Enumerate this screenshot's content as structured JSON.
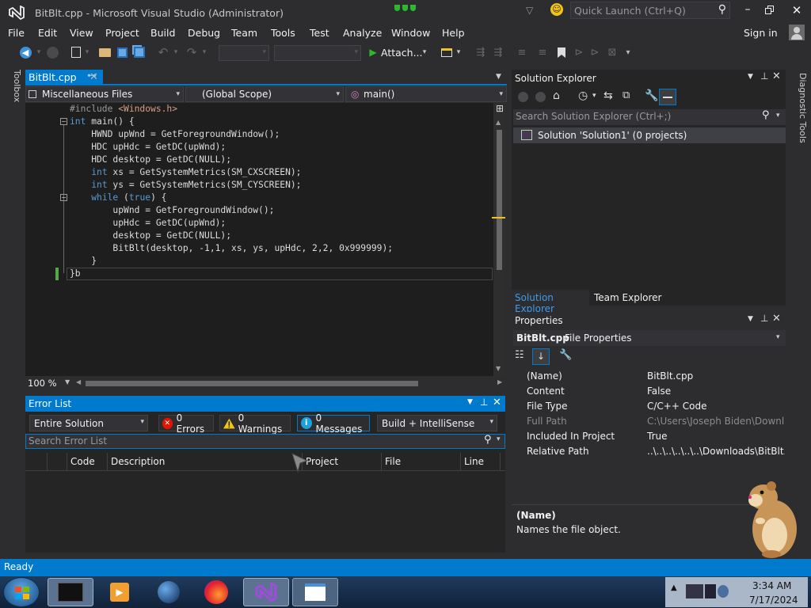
{
  "window": {
    "title": "BitBlt.cpp - Microsoft Visual Studio (Administrator)",
    "quick_launch_placeholder": "Quick Launch (Ctrl+Q)",
    "sign_in": "Sign in"
  },
  "menu": [
    "File",
    "Edit",
    "View",
    "Project",
    "Build",
    "Debug",
    "Team",
    "Tools",
    "Test",
    "Analyze",
    "Window",
    "Help"
  ],
  "toolbar": {
    "attach_label": "Attach..."
  },
  "side_tabs": {
    "toolbox": "Toolbox",
    "diagnostic_tools": "Diagnostic Tools"
  },
  "editor": {
    "tab_label": "BitBlt.cpp",
    "nav_project": "Miscellaneous Files",
    "nav_scope": "(Global Scope)",
    "nav_member": "main()",
    "zoom": "100 %",
    "code": [
      {
        "segments": [
          {
            "t": "#include ",
            "c": "pp"
          },
          {
            "t": "<Windows.h>",
            "c": "inc"
          }
        ]
      },
      {
        "segments": [
          {
            "t": "int",
            "c": "kw"
          },
          {
            "t": " main() {",
            "c": ""
          }
        ]
      },
      {
        "segments": [
          {
            "t": "    HWND upWnd = GetForegroundWindow();",
            "c": ""
          }
        ]
      },
      {
        "segments": [
          {
            "t": "    HDC upHdc = GetDC(upWnd);",
            "c": ""
          }
        ]
      },
      {
        "segments": [
          {
            "t": "    HDC desktop = GetDC(NULL);",
            "c": ""
          }
        ]
      },
      {
        "segments": [
          {
            "t": "    ",
            "c": ""
          },
          {
            "t": "int",
            "c": "kw"
          },
          {
            "t": " xs = GetSystemMetrics(SM_CXSCREEN);",
            "c": ""
          }
        ]
      },
      {
        "segments": [
          {
            "t": "    ",
            "c": ""
          },
          {
            "t": "int",
            "c": "kw"
          },
          {
            "t": " ys = GetSystemMetrics(SM_CYSCREEN);",
            "c": ""
          }
        ]
      },
      {
        "segments": [
          {
            "t": "    ",
            "c": ""
          },
          {
            "t": "while",
            "c": "kw"
          },
          {
            "t": " (",
            "c": ""
          },
          {
            "t": "true",
            "c": "kw"
          },
          {
            "t": ") {",
            "c": ""
          }
        ]
      },
      {
        "segments": [
          {
            "t": "        upWnd = GetForegroundWindow();",
            "c": ""
          }
        ]
      },
      {
        "segments": [
          {
            "t": "        upHdc = GetDC(upWnd);",
            "c": ""
          }
        ]
      },
      {
        "segments": [
          {
            "t": "        desktop = GetDC(NULL);",
            "c": ""
          }
        ]
      },
      {
        "segments": [
          {
            "t": "        BitBlt(desktop, -1,1, xs, ys, upHdc, 2,2, 0x999999);",
            "c": ""
          }
        ]
      },
      {
        "segments": [
          {
            "t": "    }",
            "c": ""
          }
        ]
      },
      {
        "segments": [
          {
            "t": "}b",
            "c": ""
          }
        ]
      }
    ]
  },
  "error_list": {
    "title": "Error List",
    "scope": "Entire Solution",
    "errors": "0 Errors",
    "warnings": "0 Warnings",
    "messages": "0 Messages",
    "build_filter": "Build + IntelliSense",
    "search_placeholder": "Search Error List",
    "columns": [
      "Code",
      "Description",
      "Project",
      "File",
      "Line"
    ]
  },
  "solution_explorer": {
    "title": "Solution Explorer",
    "search_placeholder": "Search Solution Explorer (Ctrl+;)",
    "solution_item": "Solution 'Solution1' (0 projects)",
    "tabs": [
      "Solution Explorer",
      "Team Explorer"
    ]
  },
  "properties": {
    "title": "Properties",
    "object_name": "BitBlt.cpp",
    "object_type": "File Properties",
    "rows": [
      {
        "name": "(Name)",
        "value": "BitBlt.cpp",
        "disabled": false
      },
      {
        "name": "Content",
        "value": "False",
        "disabled": false
      },
      {
        "name": "File Type",
        "value": "C/C++ Code",
        "disabled": false
      },
      {
        "name": "Full Path",
        "value": "C:\\Users\\Joseph Biden\\Download",
        "disabled": true
      },
      {
        "name": "Included In Project",
        "value": "True",
        "disabled": false
      },
      {
        "name": "Relative Path",
        "value": "..\\..\\..\\..\\..\\..\\Downloads\\BitBlt.cp",
        "disabled": false
      }
    ],
    "desc_title": "(Name)",
    "desc_text": "Names the file object."
  },
  "status": {
    "text": "Ready"
  },
  "taskbar": {
    "time": "3:34 AM",
    "date": "7/17/2024"
  },
  "colors": {
    "accent": "#007acc",
    "bg": "#2d2d30",
    "editor": "#1e1e1e",
    "keyword": "#569cd6"
  }
}
